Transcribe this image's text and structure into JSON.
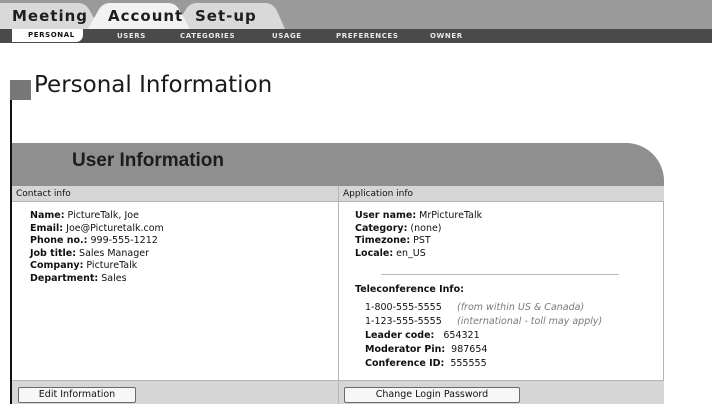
{
  "tabs": [
    {
      "label": "Meeting"
    },
    {
      "label": "Account"
    },
    {
      "label": "Set-up"
    }
  ],
  "subnav": [
    {
      "label": "PERSONAL",
      "active": true
    },
    {
      "label": "USERS"
    },
    {
      "label": "CATEGORIES"
    },
    {
      "label": "USAGE"
    },
    {
      "label": "PREFERENCES"
    },
    {
      "label": "OWNER"
    }
  ],
  "page": {
    "title": "Personal Information"
  },
  "panel": {
    "title": "User Information",
    "contact": {
      "heading": "Contact info",
      "name_label": "Name:",
      "name": "PictureTalk, Joe",
      "email_label": "Email:",
      "email": "Joe@Picturetalk.com",
      "phone_label": "Phone no.:",
      "phone": "999-555-1212",
      "job_label": "Job title:",
      "job": "Sales Manager",
      "company_label": "Company:",
      "company": "PictureTalk",
      "dept_label": "Department:",
      "dept": "Sales",
      "edit_button": "Edit Information"
    },
    "application": {
      "heading": "Application info",
      "username_label": "User name:",
      "username": "MrPictureTalk",
      "category_label": "Category:",
      "category": "(none)",
      "timezone_label": "Timezone:",
      "timezone": "PST",
      "locale_label": "Locale:",
      "locale": "en_US",
      "tele_heading": "Teleconference Info:",
      "phone1": "1-800-555-5555",
      "phone1_note": "(from within US & Canada)",
      "phone2": "1-123-555-5555",
      "phone2_note": "(international - toll may apply)",
      "leader_label": "Leader code:",
      "leader": "654321",
      "moderator_label": "Moderator Pin:",
      "moderator": "987654",
      "conference_label": "Conference ID:",
      "conference": "555555",
      "password_button": "Change Login Password"
    }
  },
  "colors": {
    "topbar": "#9a9a9a",
    "tab": "#d9d9d9",
    "tab_active": "#f2f2f2",
    "subnav": "#4a4a4a",
    "panel_header": "#8f8f8f",
    "column_header": "#d6d6d6"
  }
}
